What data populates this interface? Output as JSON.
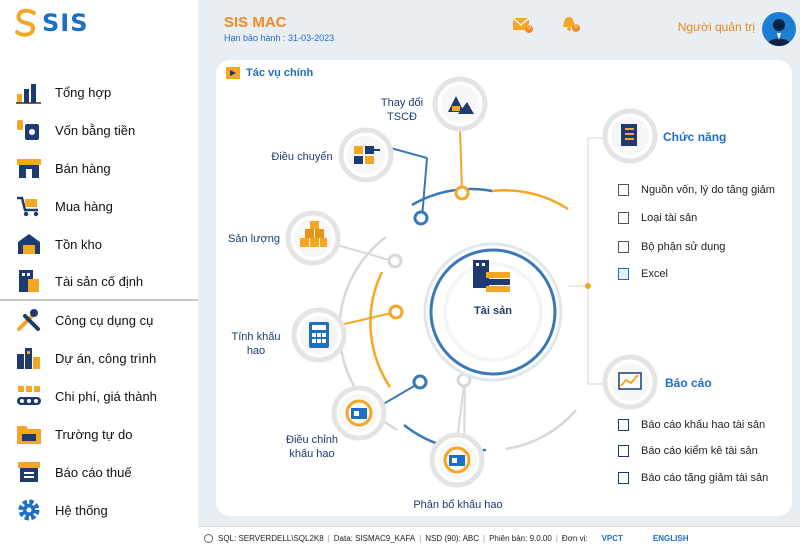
{
  "brand": {
    "logo_text": "SIS"
  },
  "header": {
    "app_title": "SIS MAC",
    "expiry": "Hạn bảo hành : 31-03-2023",
    "mail_badge": "0",
    "bell_badge": "0",
    "admin_label": "Người quản trị"
  },
  "sidebar": {
    "items": [
      {
        "label": "Tổng hợp",
        "icon": "bar-chart-icon"
      },
      {
        "label": "Vốn bằng tiền",
        "icon": "money-icon"
      },
      {
        "label": "Bán hàng",
        "icon": "store-icon"
      },
      {
        "label": "Mua hàng",
        "icon": "shopping-cart-icon"
      },
      {
        "label": "Tồn kho",
        "icon": "warehouse-icon"
      },
      {
        "label": "Tài sản cố định",
        "icon": "building-icon"
      },
      {
        "label": "Công cụ dụng cụ",
        "icon": "tools-icon"
      },
      {
        "label": "Dự án, công trình",
        "icon": "city-icon"
      },
      {
        "label": "Chi phí, giá thành",
        "icon": "conveyor-icon"
      },
      {
        "label": "Trường tự do",
        "icon": "folder-icon"
      },
      {
        "label": "Báo cáo thuế",
        "icon": "tax-report-icon"
      },
      {
        "label": "Hệ thống",
        "icon": "gear-icon"
      }
    ],
    "active_index": 5
  },
  "panel": {
    "title": "Tác vụ chính",
    "center_label": "Tài sản",
    "nodes": [
      {
        "name": "thay-doi-tscd",
        "label": "Thay đổi\nTSCĐ"
      },
      {
        "name": "dieu-chuyen",
        "label": "Điều chuyển"
      },
      {
        "name": "san-luong",
        "label": "Sản lượng"
      },
      {
        "name": "tinh-khau-hao",
        "label": "Tính khấu\nhao"
      },
      {
        "name": "dieu-chinh-khau-hao",
        "label": "Điều chỉnh\nkhấu hao"
      },
      {
        "name": "phan-bo-khau-hao",
        "label": "Phân bổ khấu hao"
      }
    ],
    "functions": {
      "heading": "Chức năng",
      "items": [
        "Nguồn vốn, lý do tăng giảm",
        "Loại tài sản",
        "Bộ phận sử dụng",
        "Excel"
      ]
    },
    "reports": {
      "heading": "Báo cáo",
      "items": [
        "Báo cáo khấu hao tài sản",
        "Báo cáo kiểm kê tài sản",
        "Báo cáo tăng giảm tài sản"
      ]
    }
  },
  "status": {
    "sql": "SQL: SERVERDELL\\SQL2K8",
    "data": "Data: SISMAC9_KAFA",
    "nsd": "NSD (90): ABC",
    "version": "Phiên bản: 9.0.00",
    "unit_label": "Đơn vị:",
    "unit_value": "VPCT",
    "language": "ENGLISH"
  },
  "colors": {
    "accent_orange": "#f5a623",
    "accent_blue": "#1d6fc4",
    "line_blue": "#3a78b8"
  }
}
